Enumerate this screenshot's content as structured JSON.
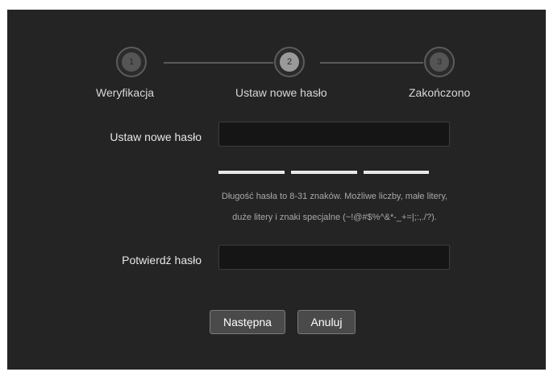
{
  "steps": [
    {
      "number": "1",
      "label": "Weryfikacja",
      "state": "done"
    },
    {
      "number": "2",
      "label": "Ustaw nowe hasło",
      "state": "active"
    },
    {
      "number": "3",
      "label": "Zakończono",
      "state": "pending"
    }
  ],
  "form": {
    "new_password": {
      "label": "Ustaw nowe hasło",
      "value": ""
    },
    "strength_segments": 3,
    "hint": "Długość hasła to 8-31 znaków. Możliwe liczby, małe litery, duże litery i znaki specjalne (~!@#$%^&*-_+=|;:,./?).",
    "confirm_password": {
      "label": "Potwierdź hasło",
      "value": ""
    }
  },
  "buttons": {
    "next": "Następna",
    "cancel": "Anuluj"
  },
  "colors": {
    "panel_background": "#242424",
    "input_background": "#151515",
    "button_background": "#4a4a4a",
    "text": "#e6e6e6",
    "hint_text": "#a8a8a8"
  }
}
